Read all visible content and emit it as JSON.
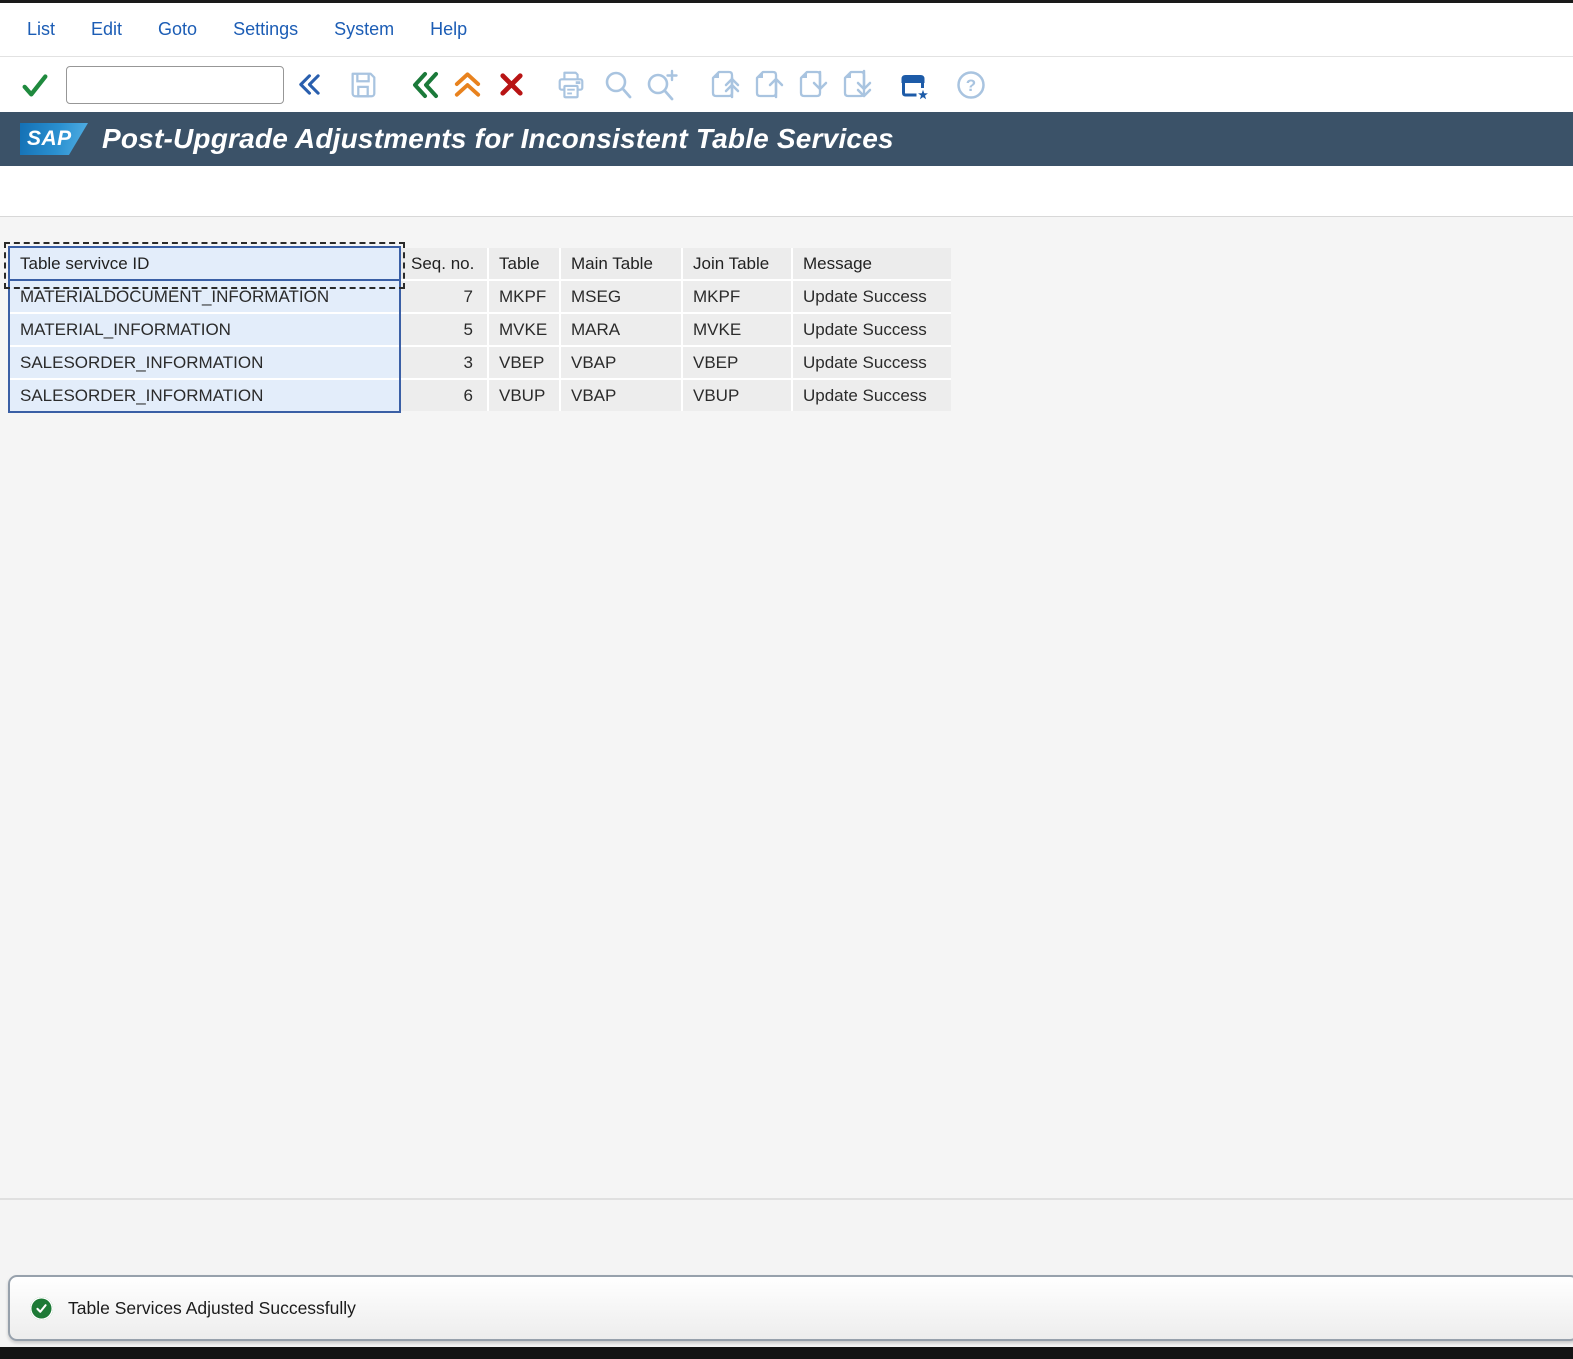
{
  "menu": {
    "items": [
      "List",
      "Edit",
      "Goto",
      "Settings",
      "System",
      "Help"
    ]
  },
  "toolbar": {
    "command_field": {
      "value": "",
      "placeholder": ""
    },
    "icons": [
      {
        "name": "enter-icon",
        "glyph": "green-check",
        "color": "#1f8a3e"
      },
      {
        "name": "collapse-command-field-icon",
        "glyph": "double-chevron-left",
        "color": "#2a5fae"
      },
      {
        "name": "save-icon",
        "glyph": "floppy-disk",
        "color": "#a9c4e0"
      },
      {
        "name": "back-icon",
        "glyph": "double-chevron-left",
        "color": "#1b7a3a"
      },
      {
        "name": "exit-icon",
        "glyph": "double-chevron-up",
        "color": "#e8821e"
      },
      {
        "name": "cancel-icon",
        "glyph": "x-mark",
        "color": "#b81414"
      },
      {
        "name": "print-icon",
        "glyph": "printer",
        "color": "#a9c4e0"
      },
      {
        "name": "find-icon",
        "glyph": "magnifier",
        "color": "#a9c4e0"
      },
      {
        "name": "find-next-icon",
        "glyph": "magnifier-plus",
        "color": "#a9c4e0"
      },
      {
        "name": "first-page-icon",
        "glyph": "page-arrow-double-up",
        "color": "#a9c4e0"
      },
      {
        "name": "previous-page-icon",
        "glyph": "page-arrow-up",
        "color": "#a9c4e0"
      },
      {
        "name": "next-page-icon",
        "glyph": "page-arrow-down",
        "color": "#a9c4e0"
      },
      {
        "name": "last-page-icon",
        "glyph": "page-arrow-double-down",
        "color": "#a9c4e0"
      },
      {
        "name": "create-shortcut-icon",
        "glyph": "window-star",
        "color": "#1d5ba8"
      },
      {
        "name": "help-icon",
        "glyph": "question-circle",
        "color": "#a9c4e0"
      }
    ]
  },
  "header": {
    "logo": "SAP",
    "title": "Post-Upgrade Adjustments for Inconsistent Table Services"
  },
  "table": {
    "columns": [
      "Table servivce ID",
      "Seq. no.",
      "Table",
      "Main Table",
      "Join Table",
      "Message"
    ],
    "selected_column": "Table servivce ID",
    "rows": [
      {
        "id": "MATERIALDOCUMENT_INFORMATION",
        "seq": "7",
        "table": "MKPF",
        "main_table": "MSEG",
        "join_table": "MKPF",
        "message": "Update Success"
      },
      {
        "id": "MATERIAL_INFORMATION",
        "seq": "5",
        "table": "MVKE",
        "main_table": "MARA",
        "join_table": "MVKE",
        "message": "Update Success"
      },
      {
        "id": "SALESORDER_INFORMATION",
        "seq": "3",
        "table": "VBEP",
        "main_table": "VBAP",
        "join_table": "VBEP",
        "message": "Update Success"
      },
      {
        "id": "SALESORDER_INFORMATION",
        "seq": "6",
        "table": "VBUP",
        "main_table": "VBAP",
        "join_table": "VBUP",
        "message": "Update Success"
      }
    ]
  },
  "status": {
    "message": "Table Services Adjusted Successfully",
    "state": "success",
    "icon": "success-check-icon"
  },
  "colors": {
    "titlebar_bg": "#3b5268",
    "menu_text": "#1c5db5",
    "enter_green": "#1f8a3e",
    "back_green": "#1b7a3a",
    "exit_orange": "#e8821e",
    "cancel_red": "#b81414",
    "pale_icon": "#a9c4e0",
    "shortcut_blue": "#1d5ba8",
    "sap_logo_blue": "#1470b4",
    "selection_bg": "#e3edfa",
    "selection_border": "#3a5fa5",
    "header_cell_bg": "#ececec",
    "cell_bg": "#ededed",
    "status_green": "#1d7a36"
  }
}
